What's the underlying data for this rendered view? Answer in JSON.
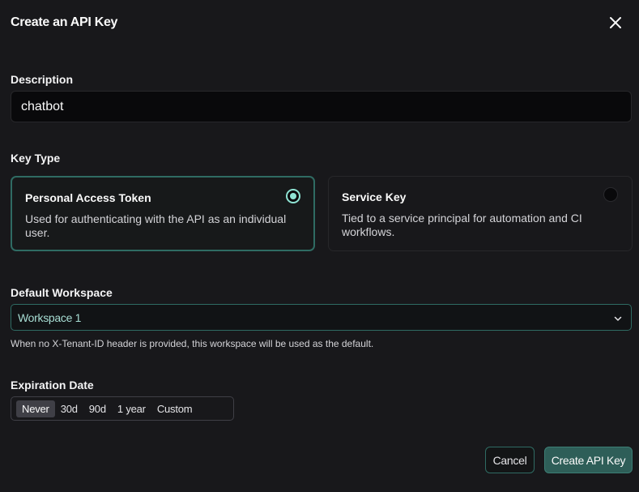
{
  "dialog": {
    "title": "Create an API Key",
    "close_icon": "close-icon"
  },
  "description": {
    "label": "Description",
    "value": "chatbot"
  },
  "key_type": {
    "label": "Key Type",
    "options": [
      {
        "title": "Personal Access Token",
        "description": "Used for authenticating with the API as an individual user.",
        "selected": true
      },
      {
        "title": "Service Key",
        "description": "Tied to a service principal for automation and CI workflows.",
        "selected": false
      }
    ]
  },
  "workspace": {
    "label": "Default Workspace",
    "selected": "Workspace 1",
    "helper": "When no X-Tenant-ID header is provided, this workspace will be used as the default.",
    "chevron_icon": "chevron-down-icon"
  },
  "expiration": {
    "label": "Expiration Date",
    "options": [
      "Never",
      "30d",
      "90d",
      "1 year",
      "Custom"
    ],
    "selected": "Never"
  },
  "actions": {
    "cancel_label": "Cancel",
    "create_label": "Create API Key"
  },
  "colors": {
    "background": "#18181b",
    "accent": "#8fe3d3",
    "accent_border": "#2f6b63",
    "primary_button": "#2e5e58"
  }
}
